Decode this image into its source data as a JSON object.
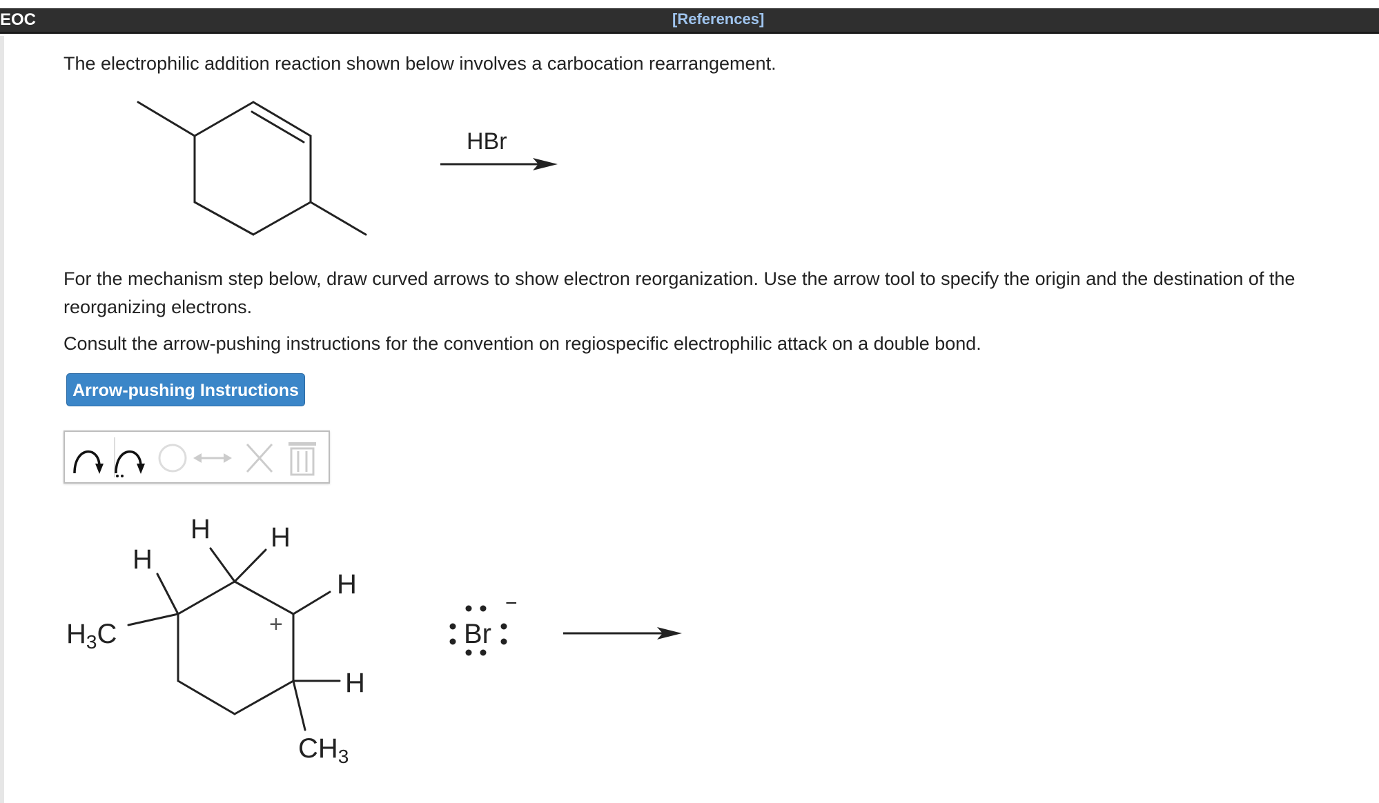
{
  "header": {
    "course": "EOC",
    "references_link": "[References]"
  },
  "prompt": {
    "intro": "The electrophilic addition reaction shown below involves a carbocation rearrangement.",
    "instructions": "For the mechanism step below, draw curved arrows to show electron reorganization. Use the arrow tool to specify the origin and the destination of the reorganizing electrons.",
    "consult": "Consult the arrow-pushing instructions for the convention on regiospecific electrophilic attack on a double bond."
  },
  "reaction": {
    "reagent": "HBr"
  },
  "button": {
    "label": "Arrow-pushing Instructions"
  },
  "toolbar": {
    "tools": [
      "curved-arrow-tool",
      "fishhook-arrow-tool",
      "ring-tool",
      "resonance-arrow-tool",
      "delete-tool",
      "trash-tool"
    ]
  },
  "mechanism": {
    "labels": {
      "h_top_left": "H",
      "h_top_right": "H",
      "h_left": "H",
      "methyl_left": "H3C",
      "h_right_upper": "H",
      "h_right_lower": "H",
      "methyl_bottom": "CH3",
      "charge_plus": "+",
      "bromide": "Br",
      "bromide_charge": "−"
    }
  },
  "colors": {
    "header_bg": "#2f2f2f",
    "link": "#9fc4ee",
    "button_bg": "#3b86c8"
  }
}
